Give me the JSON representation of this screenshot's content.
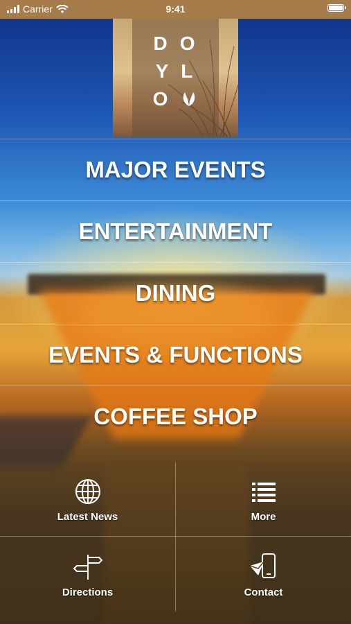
{
  "status_bar": {
    "carrier": "Carrier",
    "time": "9:41",
    "battery_level": 1.0
  },
  "logo": {
    "rows": [
      [
        "D",
        "O"
      ],
      [
        "Y",
        "L"
      ],
      [
        "O",
        ""
      ]
    ]
  },
  "menu": [
    {
      "label": "MAJOR EVENTS"
    },
    {
      "label": "ENTERTAINMENT"
    },
    {
      "label": "DINING"
    },
    {
      "label": "EVENTS & FUNCTIONS"
    },
    {
      "label": "COFFEE SHOP"
    }
  ],
  "tiles": [
    {
      "label": "Latest News",
      "icon": "globe-icon"
    },
    {
      "label": "More",
      "icon": "list-icon"
    },
    {
      "label": "Directions",
      "icon": "signpost-icon"
    },
    {
      "label": "Contact",
      "icon": "phone-contact-icon"
    }
  ],
  "colors": {
    "status_bar_bg": "#a67c4a",
    "menu_text": "#ffffff"
  }
}
